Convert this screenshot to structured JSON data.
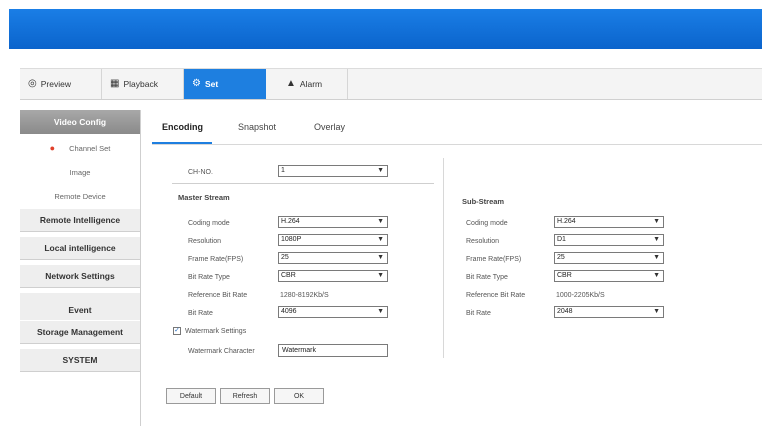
{
  "colors": {
    "accent": "#1e7fe0",
    "topbar": "#1a7ee6",
    "sidebar_head": "#999999"
  },
  "nav": {
    "preview": {
      "label": "Preview",
      "icon": "camera-icon"
    },
    "playback": {
      "label": "Playback",
      "icon": "film-icon"
    },
    "set": {
      "label": "Set",
      "icon": "gear-icon"
    },
    "alarm": {
      "label": "Alarm",
      "icon": "bell-icon"
    }
  },
  "sidebar": {
    "video_config": "Video Config",
    "channel_set": "Channel Set",
    "image": "Image",
    "remote_device": "Remote Device",
    "groups": [
      "Remote Intelligence",
      "Local intelligence",
      "Network Settings",
      "Event",
      "Storage Management",
      "SYSTEM"
    ]
  },
  "subtabs": {
    "encoding": "Encoding",
    "snapshot": "Snapshot",
    "overlay": "Overlay"
  },
  "channel": {
    "label": "CH-NO.",
    "value": "1"
  },
  "main_stream": {
    "title": "Master Stream",
    "coding_mode": {
      "label": "Coding mode",
      "value": "H.264"
    },
    "resolution": {
      "label": "Resolution",
      "value": "1080P"
    },
    "frame_rate": {
      "label": "Frame Rate(FPS)",
      "value": "25"
    },
    "bit_rate_type": {
      "label": "Bit Rate Type",
      "value": "CBR"
    },
    "reference_bit_rate": {
      "label": "Reference Bit Rate",
      "value": "1280-8192Kb/S"
    },
    "bit_rate": {
      "label": "Bit Rate",
      "value": "4096"
    }
  },
  "watermark": {
    "settings_label": "Watermark Settings",
    "character_label": "Watermark Character",
    "character_value": "Watermark"
  },
  "sub_stream": {
    "title": "Sub-Stream",
    "coding_mode": {
      "label": "Coding mode",
      "value": "H.264"
    },
    "resolution": {
      "label": "Resolution",
      "value": "D1"
    },
    "frame_rate": {
      "label": "Frame Rate(FPS)",
      "value": "25"
    },
    "bit_rate_type": {
      "label": "Bit Rate Type",
      "value": "CBR"
    },
    "reference_bit_rate": {
      "label": "Reference Bit Rate",
      "value": "1000-2205Kb/S"
    },
    "bit_rate": {
      "label": "Bit Rate",
      "value": "2048"
    }
  },
  "buttons": {
    "default": "Default",
    "refresh": "Refresh",
    "ok": "OK"
  }
}
